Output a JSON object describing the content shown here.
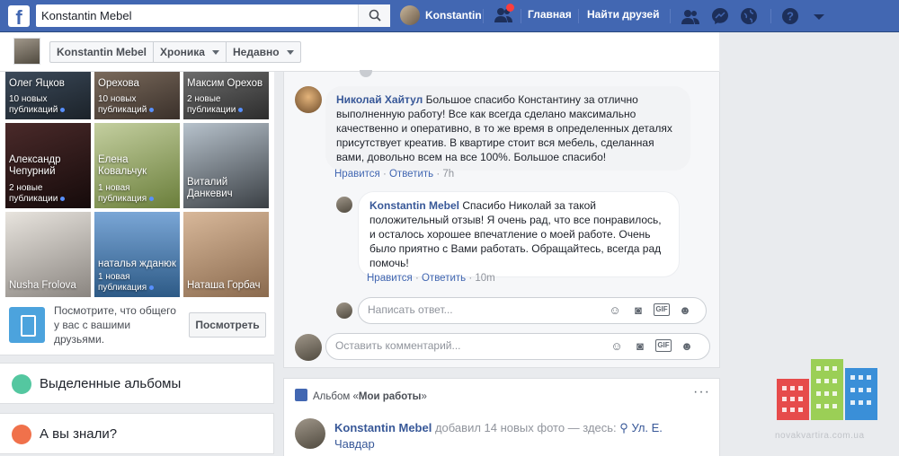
{
  "topbar": {
    "search_value": "Konstantin Mebel",
    "profile_name": "Konstantin",
    "home_label": "Главная",
    "find_friends_label": "Найти друзей"
  },
  "profile_header": {
    "name": "Konstantin Mebel",
    "timeline_label": "Хроника",
    "recent_label": "Недавно"
  },
  "friends": [
    {
      "name": "Олег Яцков",
      "count": "10 новых публикаций"
    },
    {
      "name": "Орехова",
      "count": "10 новых публикаций"
    },
    {
      "name": "Максим Орехов",
      "count": "2 новые публикации"
    },
    {
      "name": "Александр Чепурний",
      "count": "2 новые публикации"
    },
    {
      "name": "Елена Ковальчук",
      "count": "1 новая публикация"
    },
    {
      "name": "Виталий Данкевич",
      "count": ""
    },
    {
      "name": "Nusha Frolova",
      "count": ""
    },
    {
      "name": "наталья жданюк",
      "count": "1 новая публикация"
    },
    {
      "name": "Наташа Горбач",
      "count": ""
    }
  ],
  "promo": {
    "text": "Посмотрите, что общего у вас с вашими друзьями.",
    "button": "Посмотреть"
  },
  "side_cards": {
    "albums": "Выделенные альбомы",
    "did_you_know": "А вы знали?"
  },
  "comments": {
    "c1_author": "Николай Хайтул",
    "c1_text": "Большое спасибо Константину за отлично выполненную работу! Все как всегда сделано максимально качественно и оперативно, в то же время в определенных деталях присутствует креатив. В квартире стоит вся мебель, сделанная вами, довольно всем на все 100%. Большое спасибо!",
    "c1_like": "Нравится",
    "c1_reply": "Ответить",
    "c1_time": "7h",
    "r1_author": "Konstantin Mebel",
    "r1_text": "Спасибо Николай за такой положительный отзыв! Я очень рад, что все понравилось, и осталось хорошее впечатление о моей работе. Очень было приятно с Вами работать. Обращайтесь, всегда рад помочь!",
    "r1_like": "Нравится",
    "r1_reply": "Ответить",
    "r1_time": "10m",
    "reply_placeholder": "Написать ответ...",
    "comment_placeholder": "Оставить комментарий..."
  },
  "album": {
    "prefix": "Альбом «",
    "name": "Мои работы",
    "suffix": "»",
    "post_author": "Konstantin Mebel",
    "post_text": "добавил 14 новых фото — здесь:",
    "place": "Ул. Е. Чавдар"
  },
  "watermark": "novakvartira.com.ua"
}
